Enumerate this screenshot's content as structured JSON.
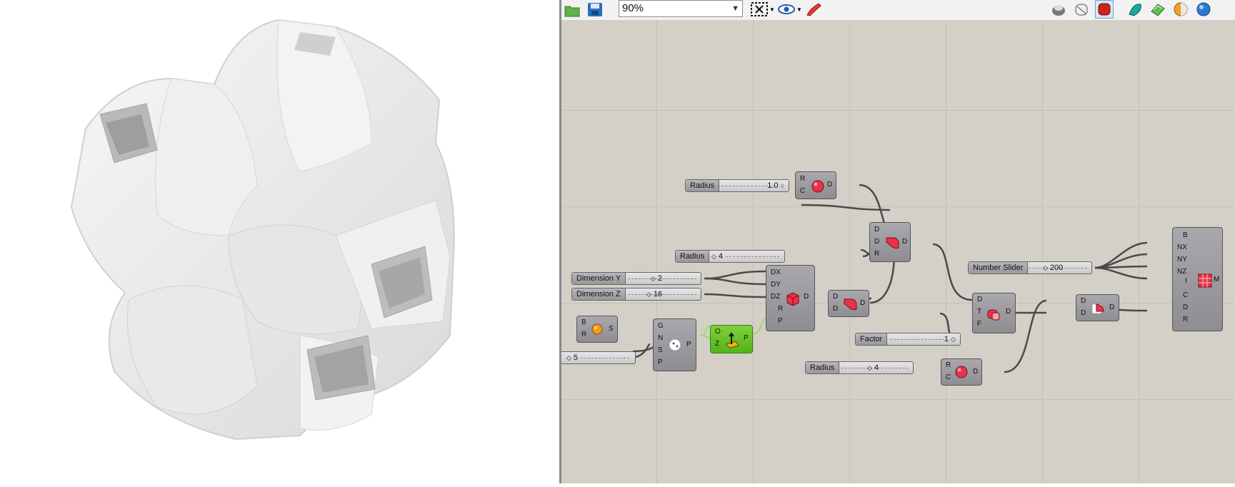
{
  "toolbar": {
    "zoom_value": "90%",
    "icons": [
      "open-file-icon",
      "save-file-icon",
      "zoom-extents-icon",
      "preview-eye-icon",
      "sketch-pen-icon",
      "preview-off-icon",
      "preview-wire-icon",
      "preview-shaded-icon",
      "bake-icon",
      "solid-icon",
      "material-icon",
      "sphere-icon"
    ]
  },
  "canvas": {
    "sliders": {
      "radius1": {
        "label": "Radius",
        "value": "1.0"
      },
      "radius2": {
        "label": "Radius",
        "value": "4"
      },
      "dim_y": {
        "label": "Dimension Y",
        "value": "2"
      },
      "dim_z": {
        "label": "Dimension Z",
        "value": "16"
      },
      "count": {
        "label": "",
        "value": "5"
      },
      "factor": {
        "label": "Factor",
        "value": "1"
      },
      "radius3": {
        "label": "Radius",
        "value": "4"
      },
      "number": {
        "label": "Number Slider",
        "value": "200"
      }
    },
    "components": {
      "sphere_rc": {
        "inputs": [
          "R",
          "C"
        ],
        "outputs": [
          "D"
        ]
      },
      "union": {
        "inputs": [
          "D",
          "D",
          "R"
        ],
        "outputs": [
          "D"
        ]
      },
      "box": {
        "inputs": [
          "DX",
          "DY",
          "DZ",
          "R",
          "P"
        ],
        "outputs": [
          "D"
        ]
      },
      "subtract": {
        "inputs": [
          "D",
          "D"
        ],
        "outputs": [
          "D"
        ]
      },
      "sphere_br": {
        "inputs": [
          "B",
          "R"
        ],
        "outputs": [
          "S"
        ]
      },
      "populate": {
        "inputs": [
          "G",
          "N",
          "S",
          "P"
        ],
        "outputs": [
          "P"
        ]
      },
      "plane": {
        "inputs": [
          "O",
          "Z"
        ],
        "outputs": [
          "P"
        ]
      },
      "smooth": {
        "inputs": [
          "D",
          "T",
          "F"
        ],
        "outputs": [
          "D"
        ]
      },
      "sphere_rc2": {
        "inputs": [
          "R",
          "C"
        ],
        "outputs": [
          "D"
        ]
      },
      "blend": {
        "inputs": [
          "D",
          "D"
        ],
        "outputs": [
          "D"
        ]
      },
      "mesh": {
        "inputs": [
          "B",
          "NX",
          "NY",
          "NZ",
          "I",
          "C",
          "D",
          "R"
        ],
        "outputs": [
          "M"
        ]
      }
    }
  },
  "colors": {
    "canvas": "#d4d0c8",
    "component": "#9b9ba0",
    "highlight": "#6cc42a",
    "wire": "#4a4a4a"
  }
}
